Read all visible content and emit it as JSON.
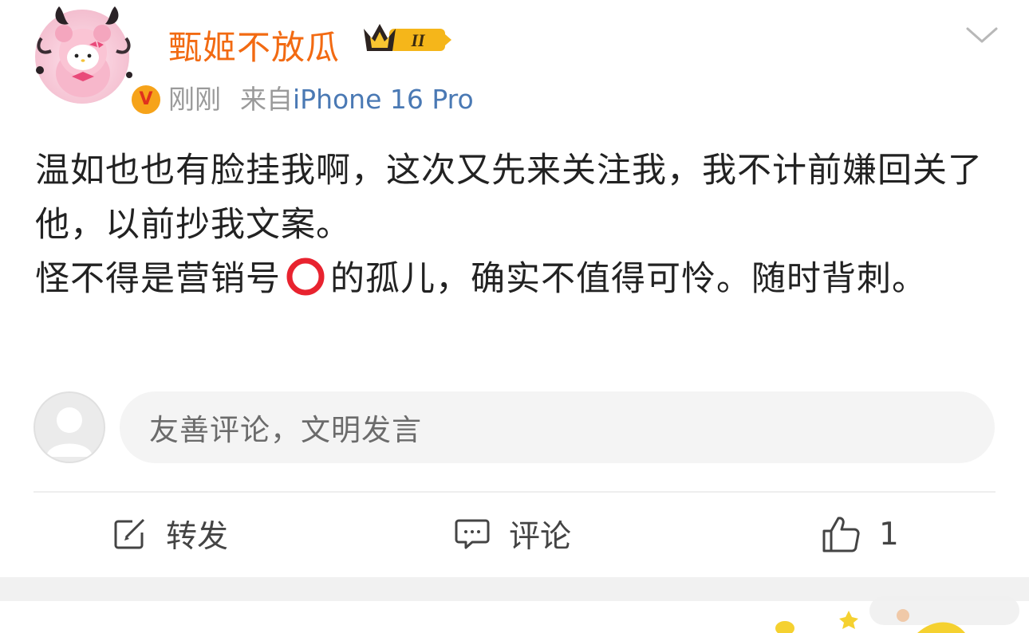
{
  "post": {
    "username": "甄姬不放瓜",
    "badge_level": "II",
    "time": "刚刚",
    "source_prefix": "来自",
    "device": "iPhone 16 Pro",
    "content_lines": [
      "温如也也有脸挂我啊，这次又先来关注我，我不计前嫌回关了他，以前抄我文案。",
      "怪不得是营销号",
      "的孤儿，确实不值得可怜。随时背刺。"
    ],
    "emoji_name": "red-circle-emoji"
  },
  "comment": {
    "placeholder": "友善评论，文明发言"
  },
  "actions": {
    "repost_label": "转发",
    "comment_label": "评论",
    "like_count": "1"
  },
  "colors": {
    "username": "#f26a12",
    "device_link": "#4a79b4",
    "meta_gray": "#9a9a9a",
    "verified_badge": "#f6a31a",
    "text": "#222222"
  },
  "icons": [
    "verified-v-icon",
    "crown-level-badge-icon",
    "chevron-down-icon",
    "repost-icon",
    "comment-icon",
    "like-icon"
  ]
}
